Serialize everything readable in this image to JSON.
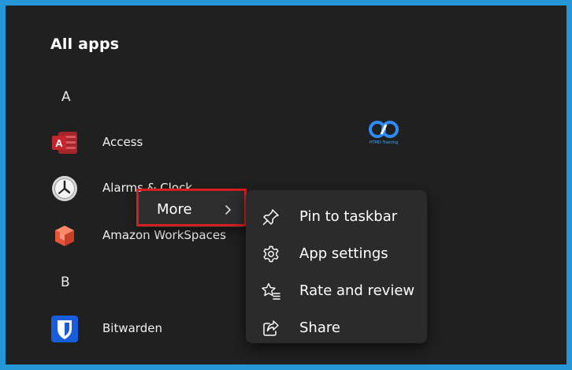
{
  "header": {
    "title": "All apps"
  },
  "groups": [
    {
      "letter": "A"
    },
    {
      "letter": "B"
    }
  ],
  "apps": [
    {
      "label": "Access",
      "icon": "access-icon"
    },
    {
      "label": "Alarms & Clock",
      "icon": "alarm-clock-icon"
    },
    {
      "label": "Amazon WorkSpaces",
      "icon": "amazon-workspaces-icon"
    },
    {
      "label": "Bitwarden",
      "icon": "bitwarden-icon"
    }
  ],
  "context_menu": {
    "more_label": "More",
    "chevron_icon": "chevron-right-icon"
  },
  "submenu": {
    "items": [
      {
        "label": "Pin to taskbar",
        "icon": "pin-icon"
      },
      {
        "label": "App settings",
        "icon": "gear-icon"
      },
      {
        "label": "Rate and review",
        "icon": "star-list-icon"
      },
      {
        "label": "Share",
        "icon": "share-icon"
      }
    ]
  },
  "watermark": {
    "text": "HTMD Training"
  },
  "colors": {
    "frame_border": "#2596d6",
    "background": "#202020",
    "highlight": "#d42020",
    "menu_bg": "#2b2b2b",
    "access_red": "#c4262e",
    "bitwarden_blue": "#175ddc"
  }
}
